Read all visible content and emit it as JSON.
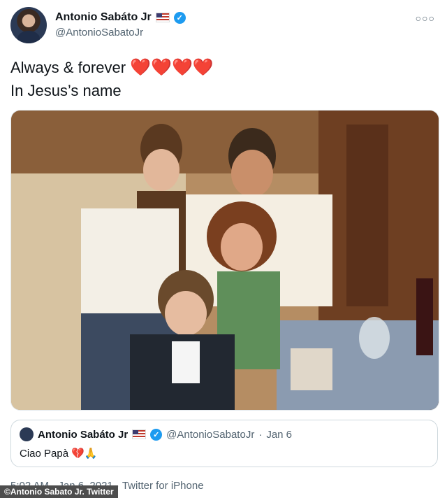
{
  "author": {
    "display_name": "Antonio Sabáto Jr",
    "handle": "@AntonioSabatoJr",
    "verified_glyph": "✓"
  },
  "tweet": {
    "line1": "Always & forever",
    "hearts": "❤️❤️❤️❤️",
    "line2": "In Jesus’s name"
  },
  "quoted": {
    "display_name": "Antonio Sabáto Jr",
    "handle": "@AntonioSabatoJr",
    "separator": "·",
    "date": "Jan 6",
    "text": "Ciao Papà 💔🙏"
  },
  "meta": {
    "timestamp": "5:02 AM · Jan 6, 2021 · Twitter for iPhone"
  },
  "credit": "©Antonio Sabato Jr. Twitter",
  "colors": {
    "accent": "#1d9bf0",
    "heart": "#e0245e",
    "secondary_text": "#536471"
  }
}
